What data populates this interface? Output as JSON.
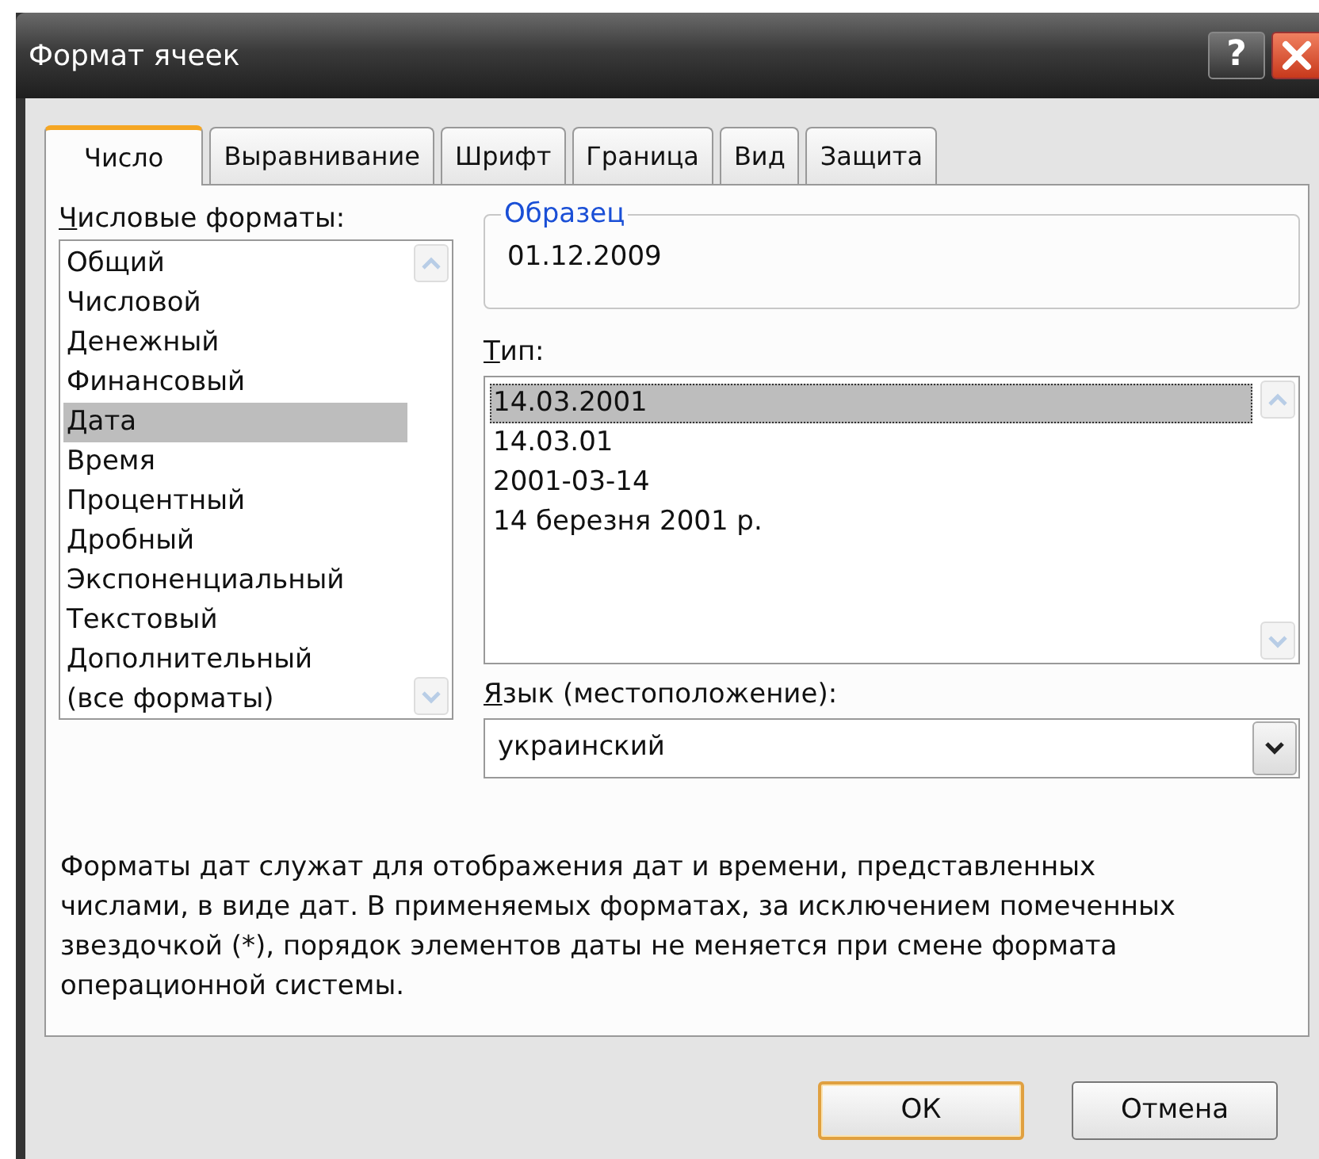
{
  "window": {
    "title": "Формат ячеек",
    "help_button": "?"
  },
  "tabs": [
    {
      "label": "Число",
      "selected": true
    },
    {
      "label": "Выравнивание",
      "selected": false
    },
    {
      "label": "Шрифт",
      "selected": false
    },
    {
      "label": "Граница",
      "selected": false
    },
    {
      "label": "Вид",
      "selected": false
    },
    {
      "label": "Защита",
      "selected": false
    }
  ],
  "number_formats": {
    "label": "Числовые форматы:",
    "items": [
      {
        "label": "Общий",
        "selected": false
      },
      {
        "label": "Числовой",
        "selected": false
      },
      {
        "label": "Денежный",
        "selected": false
      },
      {
        "label": "Финансовый",
        "selected": false
      },
      {
        "label": "Дата",
        "selected": true
      },
      {
        "label": "Время",
        "selected": false
      },
      {
        "label": "Процентный",
        "selected": false
      },
      {
        "label": "Дробный",
        "selected": false
      },
      {
        "label": "Экспоненциальный",
        "selected": false
      },
      {
        "label": "Текстовый",
        "selected": false
      },
      {
        "label": "Дополнительный",
        "selected": false
      },
      {
        "label": "(все форматы)",
        "selected": false
      }
    ]
  },
  "sample": {
    "label": "Образец",
    "value": "01.12.2009"
  },
  "type": {
    "label": "Тип:",
    "items": [
      {
        "label": "14.03.2001",
        "selected": true
      },
      {
        "label": "14.03.01",
        "selected": false
      },
      {
        "label": "2001-03-14",
        "selected": false
      },
      {
        "label": "14 березня 2001 р.",
        "selected": false
      }
    ]
  },
  "locale": {
    "label": "Язык (местоположение):",
    "value": "украинский"
  },
  "description": "Форматы дат служат для отображения дат и времени, представленных числами, в виде дат. В применяемых форматах, за исключением помеченных звездочкой (*), порядок элементов даты не меняется при смене формата операционной системы.",
  "buttons": [
    {
      "label": "ОК",
      "default": true
    },
    {
      "label": "Отмена",
      "default": false
    }
  ]
}
